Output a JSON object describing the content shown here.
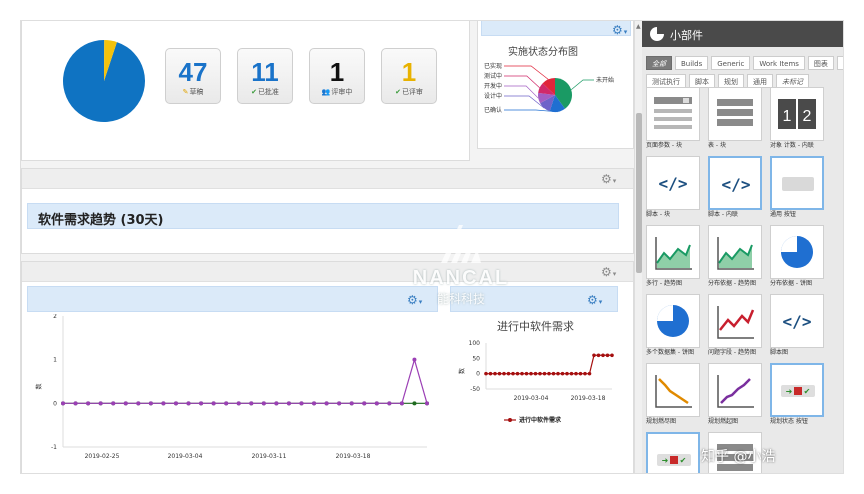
{
  "overview": {
    "pie_colors": [
      "#0f73c2",
      "#f4c20d"
    ],
    "pie_values": [
      95,
      5
    ],
    "stats": [
      {
        "value": "47",
        "label": "草稿",
        "color": "#1a73c9",
        "icon": "pencil-icon",
        "glyph": "✎"
      },
      {
        "value": "11",
        "label": "已批准",
        "color": "#1a73c9",
        "icon": "check-icon",
        "glyph": "✔"
      },
      {
        "value": "1",
        "label": "评审中",
        "color": "#111111",
        "icon": "review-icon",
        "glyph": "👥"
      },
      {
        "value": "1",
        "label": "已评审",
        "color": "#e8b200",
        "icon": "check-icon",
        "glyph": "✔"
      }
    ]
  },
  "status_dist": {
    "title": "实施状态分布图",
    "left_labels": [
      "已实现",
      "测试中",
      "开发中",
      "设计中",
      "已确认"
    ],
    "right_labels": [
      "未开始"
    ],
    "slices": [
      {
        "label": "未开始",
        "value": 40,
        "color": "#1a9a64"
      },
      {
        "label": "已确认",
        "value": 15,
        "color": "#1f6fd1"
      },
      {
        "label": "设计中",
        "value": 12,
        "color": "#6f63c9"
      },
      {
        "label": "开发中",
        "value": 10,
        "color": "#a25fc4"
      },
      {
        "label": "测试中",
        "value": 10,
        "color": "#d02a6a"
      },
      {
        "label": "已实现",
        "value": 13,
        "color": "#e0253a"
      }
    ]
  },
  "trend": {
    "title": "软件需求趋势 (30天)"
  },
  "chart_data": [
    {
      "type": "line",
      "title": "",
      "xlabel": "",
      "ylabel": "数",
      "x_ticks": [
        "2019-02-25",
        "2019-03-04",
        "2019-03-11",
        "2019-03-18"
      ],
      "ylim": [
        -1,
        2
      ],
      "y_ticks": [
        "2",
        "1",
        "0",
        "-1"
      ],
      "series": [
        {
          "color": "#1f6b1f",
          "values": [
            0,
            0,
            0,
            0,
            0,
            0,
            0,
            0,
            0,
            0,
            0,
            0,
            0,
            0,
            0,
            0,
            0,
            0,
            0,
            0,
            0,
            0,
            0,
            0,
            0,
            0,
            0,
            0,
            0,
            0
          ]
        },
        {
          "color": "#9b3fb5",
          "values": [
            0,
            0,
            0,
            0,
            0,
            0,
            0,
            0,
            0,
            0,
            0,
            0,
            0,
            0,
            0,
            0,
            0,
            0,
            0,
            0,
            0,
            0,
            0,
            0,
            0,
            0,
            0,
            0,
            1,
            0
          ]
        }
      ]
    },
    {
      "type": "line",
      "title": "进行中软件需求",
      "xlabel": "",
      "ylabel": "数",
      "x_ticks": [
        "2019-03-04",
        "2019-03-18"
      ],
      "ylim": [
        -50,
        100
      ],
      "y_ticks": [
        "100",
        "50",
        "0",
        "-50"
      ],
      "legend": "进行中软件需求",
      "series": [
        {
          "name": "进行中软件需求",
          "color": "#a50f0f",
          "values": [
            0,
            0,
            0,
            0,
            0,
            0,
            0,
            0,
            0,
            0,
            0,
            0,
            0,
            0,
            0,
            0,
            0,
            0,
            0,
            0,
            0,
            0,
            0,
            0,
            60,
            60,
            60,
            60,
            60
          ]
        }
      ]
    }
  ],
  "sidebar": {
    "title": "小部件",
    "tabs_row1": [
      "全部",
      "Builds",
      "Generic",
      "Work Items",
      "图表",
      "工作"
    ],
    "tabs_row2": [
      "测试执行",
      "脚本",
      "规划",
      "通用",
      "未标记"
    ],
    "widgets": [
      {
        "name": "页面参数 - 块",
        "icon": "form-icon"
      },
      {
        "name": "表 - 块",
        "icon": "table-icon"
      },
      {
        "name": "对象 计数 - 内联",
        "icon": "counter-icon"
      },
      {
        "name": "脚本 - 块",
        "icon": "code-icon"
      },
      {
        "name": "脚本 - 内联",
        "icon": "code-icon"
      },
      {
        "name": "通用 按钮",
        "icon": "button-icon"
      },
      {
        "name": "多行 - 趋势图",
        "icon": "area-chart-icon"
      },
      {
        "name": "分布依据 - 趋势图",
        "icon": "area-chart-icon"
      },
      {
        "name": "分布依据 - 饼图",
        "icon": "pie-chart-icon"
      },
      {
        "name": "多个数据集 - 饼图",
        "icon": "pie-chart-icon"
      },
      {
        "name": "问题字段 - 趋势图",
        "icon": "line-chart-icon"
      },
      {
        "name": "脚本图",
        "icon": "code-icon"
      },
      {
        "name": "规划燃尽图",
        "icon": "burndown-icon"
      },
      {
        "name": "规划燃起图",
        "icon": "burnup-icon"
      },
      {
        "name": "规划状态 按钮",
        "icon": "status-button-icon"
      }
    ]
  },
  "watermark": {
    "brand": "NANCAL",
    "sub": "能科科技"
  },
  "credit": "知乎 @小浩"
}
